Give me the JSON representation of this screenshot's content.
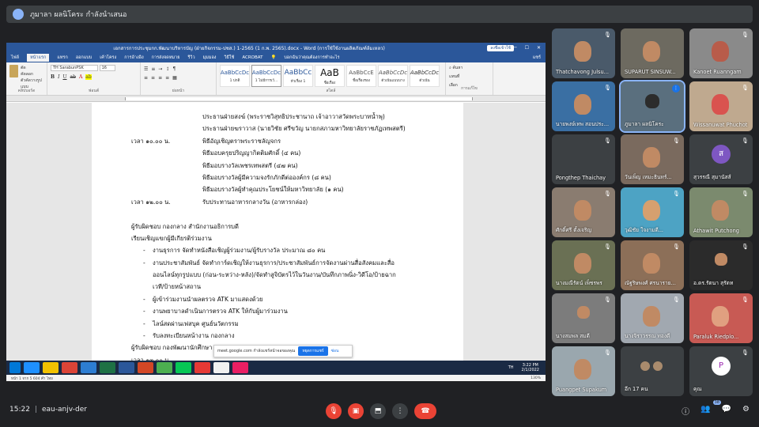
{
  "presenter": {
    "text": "ภูมาลา ผลนิโคระ กำลังนำเสนอ"
  },
  "word": {
    "title": "เอกสารการประชุมกก.พัฒนาบริหารบัญ (ฝ่ายกิจกรรม-ปชส.) 1-2565 (1 ก.พ. 2565).docx - Word (การใช้ใช้งานผลิตภัณฑ์ล้มเหลว)",
    "signin": "ลงชื่อเข้าใช้",
    "tabs": [
      "ไฟล์",
      "หน้าแรก",
      "แทรก",
      "ออกแบบ",
      "เค้าโครง",
      "การอ้างอิง",
      "การส่งจดหมาย",
      "รีวิว",
      "มุมมอง",
      "วิธีใช้",
      "ACROBAT"
    ],
    "tell_me": "บอกฉันว่าคุณต้องการทำอะไร",
    "share": "แชร์",
    "ribbon": {
      "clipboard": {
        "cut": "ตัด",
        "copy": "คัดลอก",
        "painter": "ตัวคัดวางรูปแบบ",
        "name": "คลิปบอร์ด"
      },
      "font_name": "TH SarabunPSK",
      "font_size": "16",
      "font_group": "ฟอนต์",
      "paragraph_group": "ย่อหน้า",
      "styles": [
        {
          "sample": "AaBbCcDc",
          "name": "1 ปกติ"
        },
        {
          "sample": "AaBbCcDc",
          "name": "1 ไม่มีการเว้..."
        },
        {
          "sample": "AaBbCc",
          "name": "หัวเรื่อง 1"
        },
        {
          "sample": "AaB",
          "name": "ชื่อเรื่อง"
        },
        {
          "sample": "AaBbCcE",
          "name": "ชื่อเรื่องรอง"
        },
        {
          "sample": "AaBbCcDc",
          "name": "ตัวเน้นแบบบาง"
        },
        {
          "sample": "AaBbCcDc",
          "name": "ตัวเน้น"
        }
      ],
      "styles_group": "สไตล์",
      "edit": {
        "find": "ค้นหา",
        "replace": "แทนที่",
        "select": "เลือก",
        "name": "การแก้ไข"
      }
    },
    "document": {
      "l1": "ประธานฝ่ายสงฆ์ (พระราชวิสุทธิประชานาถ เจ้าอาวาสวัดพระบาทน้ำพุ)",
      "l2": "ประธานฝ่ายฆราวาส (นายวิชัย ศรีขวัญ นายกสภามหาวิทยาลัยราชภัฏเทพสตรี)",
      "t3": "เวลา ๑๐.๐๐ น.",
      "l3": "พิธีอัญเชิญตราพระราชลัญจกร",
      "l4": "พิธีมอบครุยปริญญากิตติมศักดิ์ (๔ คน)",
      "l5": "พิธีมอบรางวัลเพชรเทพสตรี (๔๗ คน)",
      "l6": "พิธีมอบรางวัลผู้มีความจงรักภักดีต่อองค์กร (๘ คน)",
      "l7": "พิธีมอบรางวัลผู้ทำคุณประโยชน์ให้มหาวิทยาลัย (๑ คน)",
      "t8": "เวลา ๑๒.๐๐ น.",
      "l8": "รับประทานอาหารกลางวัน (อาหารกล่อง)",
      "l9": "ผู้รับผิดชอบ  กองกลาง สำนักงานอธิการบดี",
      "l10": "เรียนเชิญแขกผู้มีเกียรติร่วมงาน",
      "b1": "งานธุรการ จัดทำหนังสือเชิญผู้ร่วมงาน/ผู้รับรางวัล ประมาณ ๘๐ คน",
      "b2": "งานประชาสัมพันธ์ จัดทำการ์ดเชิญให้งานธุรการ/ประชาสัมพันธ์การจัดงานผ่านสื่อสังคมและสื่อ",
      "b2c1": "ออนไลน์ทุกรูปแบบ (ก่อน-ระหว่าง-หลัง)/จัดทำสูจิบัตรไว้ในวันงาน/บันทึกภาพนิ่ง-วิดีโอ/ป้ายฉาก",
      "b2c2": "เวที/ป้ายหน้าสถาน",
      "b3": "ผู้เข้าร่วมงานนำผลตรวจ ATK มาแสดงด้วย",
      "b4": "งานพยาบาลดำเนินการตรวจ ATK ให้กับผู้มาร่วมงาน",
      "b5": "ไลน์สดผ่านเฟสบุค ศูนย์นวัตกรรม",
      "b6": "รับลงทะเบียนหน้างาน กองกลาง",
      "l11": "ผู้รับผิดชอบ  กองพัฒนานักศึกษา",
      "t12": "เวลา ๑๓.๐๐ น."
    },
    "status_left": "หน้า 1 จาก 5    604 คำ    ไทย",
    "status_right": "130%",
    "share_notice": {
      "text": "meet.google.com กำลังแชร์หน้าจอของคุณ",
      "stop": "หยุดการแชร์",
      "hide": "ซ่อน"
    },
    "taskbar": {
      "lang": "TH",
      "time": "3:22 PM",
      "date": "2/1/2022"
    }
  },
  "participants": [
    {
      "name": "Thatchavong Julsu..."
    },
    {
      "name": "SUPARUT SINSUW..."
    },
    {
      "name": "Kanoet Ruanngam"
    },
    {
      "name": "นายพงษ์เทพ สอนประ..."
    },
    {
      "name": "ภูมาลา ผลนิโคระ"
    },
    {
      "name": "Wissanuwat Phuchot"
    },
    {
      "name": "Pongthep Thaichay"
    },
    {
      "name": "วันเพ็ญ เหมะธินทร์..."
    },
    {
      "name": "สุวรรณี สุมานัสส์",
      "initial": "ส"
    },
    {
      "name": "ศักดิ์ศรี ตั้งเจริญ"
    },
    {
      "name": "วุฒิชัย ใจงามดี..."
    },
    {
      "name": "Athawit Putchong"
    },
    {
      "name": "นางมณีรัตน์ เพ็ชรพร"
    },
    {
      "name": "ณัฐริษพงศ์ ศรนาราย..."
    },
    {
      "name": "อ.ดร.รัตนา สุรัตท"
    },
    {
      "name": "นางสมพล สมดี"
    },
    {
      "name": "นางจิราวรรณ ทองดี"
    },
    {
      "name": "Paraluk Riedplo..."
    },
    {
      "name": "Puangpet Supakum"
    },
    {
      "name": "อีก 17 คน"
    },
    {
      "name": "คุณ"
    }
  ],
  "meeting": {
    "time": "15:22",
    "code": "eau-anjv-der",
    "participant_count": "38"
  }
}
